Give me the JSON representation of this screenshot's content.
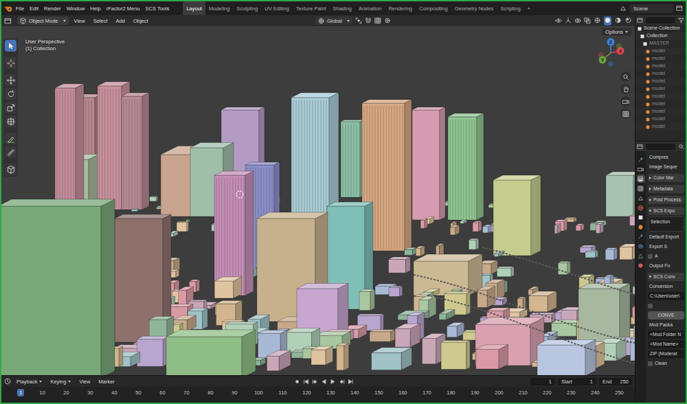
{
  "menubar": {
    "menus": [
      "File",
      "Edit",
      "Render",
      "Window",
      "Help",
      "rFactor2 Menu",
      "SCS Tools"
    ],
    "workspaces": [
      {
        "label": "Layout",
        "selected": true
      },
      {
        "label": "Modeling",
        "selected": false
      },
      {
        "label": "Sculpting",
        "selected": false
      },
      {
        "label": "UV Editing",
        "selected": false
      },
      {
        "label": "Texture Paint",
        "selected": false
      },
      {
        "label": "Shading",
        "selected": false
      },
      {
        "label": "Animation",
        "selected": false
      },
      {
        "label": "Rendering",
        "selected": false
      },
      {
        "label": "Compositing",
        "selected": false
      },
      {
        "label": "Geometry Nodes",
        "selected": false
      },
      {
        "label": "Scripting",
        "selected": false
      }
    ],
    "add_workspace": "+",
    "scene": "Scene"
  },
  "viewport_header": {
    "mode": "Object Mode",
    "menus": [
      "View",
      "Select",
      "Add",
      "Object"
    ],
    "orientation": "Global",
    "options": "Options"
  },
  "toolbar": {
    "tools": [
      {
        "selected": true
      },
      {
        "selected": false
      },
      {
        "selected": false
      },
      {
        "selected": false
      },
      {
        "selected": false
      },
      {
        "selected": false
      },
      {
        "selected": false
      },
      {
        "selected": false
      },
      {
        "selected": false
      }
    ]
  },
  "viewport": {
    "view_name": "User Perspective",
    "collection": "(1) Collection",
    "gizmo": [
      {
        "axis": "X",
        "color": "#e5454f"
      },
      {
        "axis": "Y",
        "color": "#6ba337"
      },
      {
        "axis": "Z",
        "color": "#3b82e0"
      }
    ]
  },
  "outliner": {
    "root": "Scene Collection",
    "items": [
      {
        "label": "Collection",
        "kind": "collection",
        "excluded": false
      },
      {
        "label": "MASTER",
        "kind": "child-collection",
        "excluded": true
      },
      {
        "label": "model",
        "kind": "object",
        "excluded": true
      },
      {
        "label": "model",
        "kind": "object",
        "excluded": true
      },
      {
        "label": "model",
        "kind": "object",
        "excluded": true
      },
      {
        "label": "model",
        "kind": "object",
        "excluded": true
      },
      {
        "label": "model",
        "kind": "object",
        "excluded": true
      },
      {
        "label": "model",
        "kind": "object",
        "excluded": true
      },
      {
        "label": "model",
        "kind": "object",
        "excluded": true
      },
      {
        "label": "model",
        "kind": "object",
        "excluded": true
      },
      {
        "label": "model",
        "kind": "object",
        "excluded": true
      },
      {
        "label": "model",
        "kind": "object",
        "excluded": true
      },
      {
        "label": "model",
        "kind": "object",
        "excluded": true
      }
    ]
  },
  "properties": {
    "tabs": [
      {
        "selected": false
      },
      {
        "selected": false
      },
      {
        "selected": true
      },
      {
        "selected": false
      },
      {
        "selected": false
      },
      {
        "selected": false
      },
      {
        "selected": false
      },
      {
        "selected": false
      },
      {
        "selected": false
      },
      {
        "selected": false
      },
      {
        "selected": false
      },
      {
        "selected": false
      }
    ],
    "rows": [
      {
        "kind": "label",
        "text": "Compres"
      },
      {
        "kind": "label",
        "text": "Image Seque"
      },
      {
        "kind": "panel",
        "text": "Color Mar",
        "expanded": false
      },
      {
        "kind": "panel",
        "text": "Metadata",
        "expanded": false
      },
      {
        "kind": "panel",
        "text": "Post Process",
        "expanded": false
      },
      {
        "kind": "panel",
        "text": "SCS Expo",
        "expanded": true
      },
      {
        "kind": "box",
        "text": "Selection"
      },
      {
        "kind": "label",
        "text": "Default Export"
      },
      {
        "kind": "label",
        "text": "Export S"
      },
      {
        "kind": "checkbox",
        "text": "A",
        "checked": false
      },
      {
        "kind": "label",
        "text": "Output Fo"
      },
      {
        "kind": "panel",
        "text": "SCS Conv",
        "expanded": true
      },
      {
        "kind": "label",
        "text": "Conversion"
      },
      {
        "kind": "field",
        "text": "C:\\Users\\user\\"
      },
      {
        "kind": "checkbox",
        "checked": false
      },
      {
        "kind": "button",
        "text": "CONVE"
      },
      {
        "kind": "label",
        "text": "Mod Packa"
      },
      {
        "kind": "field",
        "text": "<Mod Folder N"
      },
      {
        "kind": "field",
        "text": "<Mod Name>"
      },
      {
        "kind": "field",
        "text": "ZIP (Moderat"
      },
      {
        "kind": "checkbox",
        "text": "Clean",
        "checked": false
      }
    ]
  },
  "timeline": {
    "menus": [
      {
        "label": "Playback",
        "kind": "dropdown"
      },
      {
        "label": "Keying",
        "kind": "dropdown"
      },
      {
        "label": "View",
        "kind": "menu"
      },
      {
        "label": "Marker",
        "kind": "menu"
      }
    ],
    "current_frame": "1",
    "start_label": "Start",
    "start": "1",
    "end_label": "End",
    "end": "250",
    "ruler": [
      {
        "label": "1",
        "current": true
      },
      {
        "label": "10",
        "current": false
      },
      {
        "label": "20",
        "current": false
      },
      {
        "label": "30",
        "current": false
      },
      {
        "label": "40",
        "current": false
      },
      {
        "label": "50",
        "current": false
      },
      {
        "label": "60",
        "current": false
      },
      {
        "label": "70",
        "current": false
      },
      {
        "label": "80",
        "current": false
      },
      {
        "label": "90",
        "current": false
      },
      {
        "label": "100",
        "current": false
      },
      {
        "label": "110",
        "current": false
      },
      {
        "label": "120",
        "current": false
      },
      {
        "label": "130",
        "current": false
      },
      {
        "label": "140",
        "current": false
      },
      {
        "label": "150",
        "current": false
      },
      {
        "label": "160",
        "current": false
      },
      {
        "label": "170",
        "current": false
      },
      {
        "label": "180",
        "current": false
      },
      {
        "label": "190",
        "current": false
      },
      {
        "label": "200",
        "current": false
      },
      {
        "label": "210",
        "current": false
      },
      {
        "label": "220",
        "current": false
      },
      {
        "label": "230",
        "current": false
      },
      {
        "label": "240",
        "current": false
      },
      {
        "label": "250",
        "current": false
      }
    ]
  }
}
